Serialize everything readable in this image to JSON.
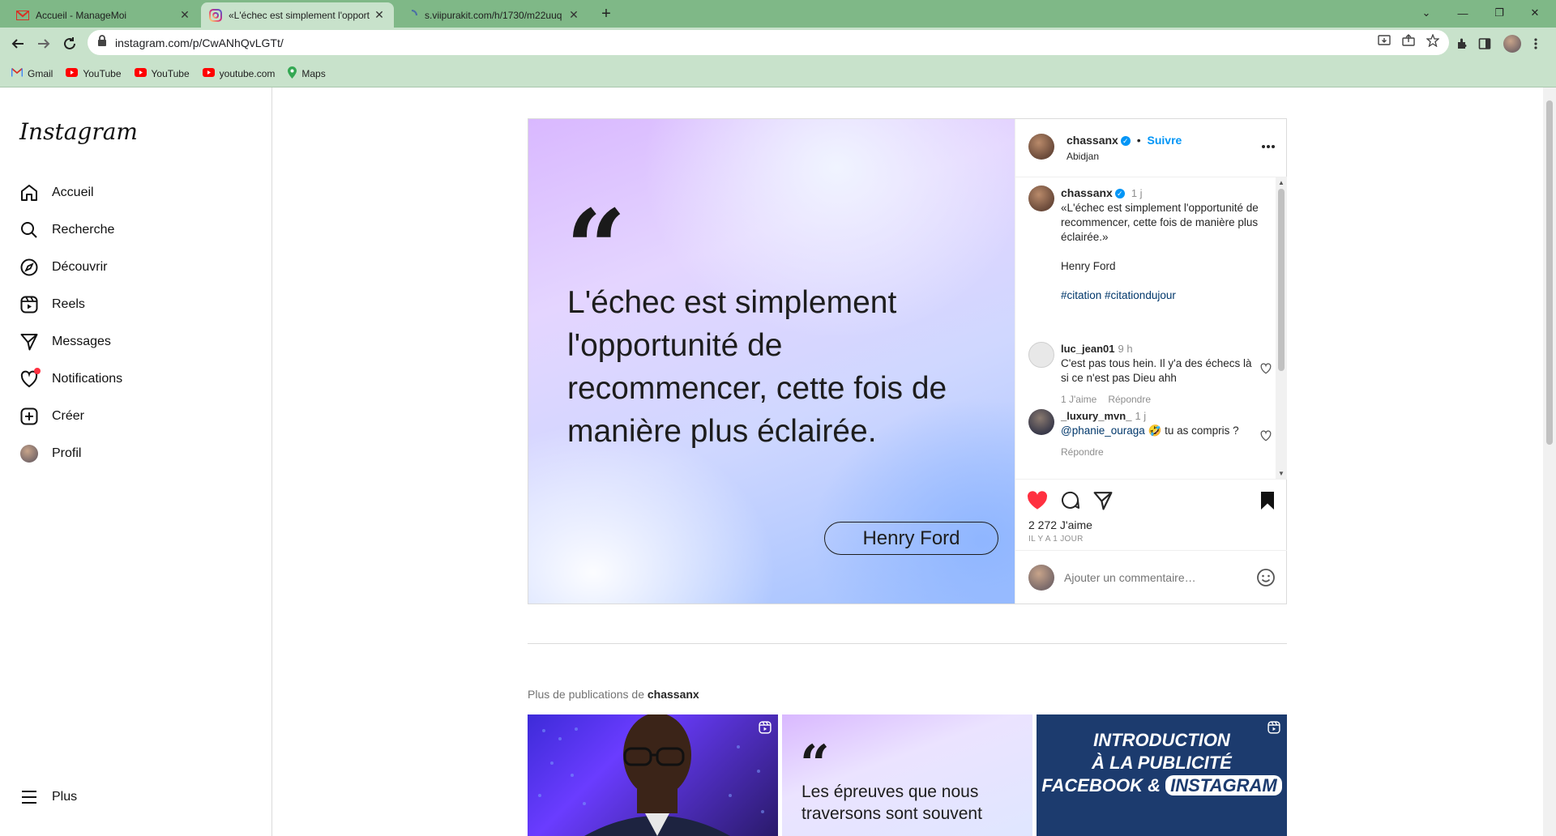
{
  "browser": {
    "tabs": [
      {
        "title": "Accueil - ManageMoi",
        "icon": "gmail-icon"
      },
      {
        "title": "«L'échec est simplement l'opport",
        "icon": "instagram-icon"
      },
      {
        "title": "s.viipurakit.com/h/1730/m22uuq",
        "icon": "loading-icon"
      }
    ],
    "url": "instagram.com/p/CwANhQvLGTt/",
    "bookmarks": [
      {
        "label": "Gmail",
        "icon": "gmail-icon"
      },
      {
        "label": "YouTube",
        "icon": "youtube-icon"
      },
      {
        "label": "YouTube",
        "icon": "youtube-icon"
      },
      {
        "label": "youtube.com",
        "icon": "youtube-icon"
      },
      {
        "label": "Maps",
        "icon": "maps-icon"
      }
    ]
  },
  "sidebar": {
    "logo": "Instagram",
    "items": [
      {
        "label": "Accueil",
        "icon": "home-icon"
      },
      {
        "label": "Recherche",
        "icon": "search-icon"
      },
      {
        "label": "Découvrir",
        "icon": "compass-icon"
      },
      {
        "label": "Reels",
        "icon": "reels-icon"
      },
      {
        "label": "Messages",
        "icon": "send-icon"
      },
      {
        "label": "Notifications",
        "icon": "heart-icon"
      },
      {
        "label": "Créer",
        "icon": "plus-square-icon"
      },
      {
        "label": "Profil",
        "icon": "avatar-icon"
      }
    ],
    "more": "Plus"
  },
  "post": {
    "image": {
      "quote": "L'échec est simplement l'opportunité de recommencer, cette fois de manière plus éclairée.",
      "author": "Henry Ford"
    },
    "header": {
      "username": "chassanx",
      "separator": "•",
      "follow": "Suivre",
      "location": "Abidjan"
    },
    "caption": {
      "username": "chassanx",
      "time": "1 j",
      "text": "«L'échec est simplement l'opportunité de recommencer, cette fois de manière plus éclairée.»",
      "author": "Henry Ford",
      "hashtags": "#citation #citationdujour"
    },
    "comments": [
      {
        "username": "luc_jean01",
        "time": "9 h",
        "text": "C'est pas tous hein. Il y'a des échecs là si ce n'est pas Dieu ahh",
        "likes": "1 J'aime",
        "reply": "Répondre"
      },
      {
        "username": "_luxury_mvn_",
        "time": "1 j",
        "mention": "@phanie_ouraga",
        "emoji": "🤣",
        "text": "tu as compris ?",
        "reply": "Répondre"
      }
    ],
    "likes": "2 272 J'aime",
    "date": "IL Y A 1 JOUR",
    "add_comment_placeholder": "Ajouter un commentaire…"
  },
  "more": {
    "prefix": "Plus de publications de",
    "username": "chassanx",
    "thumb2_text": "Les épreuves que nous traversons sont souvent",
    "thumb3_lines": [
      "INTRODUCTION",
      "À LA PUBLICITÉ",
      "FACEBOOK &",
      "INSTAGRAM"
    ]
  }
}
